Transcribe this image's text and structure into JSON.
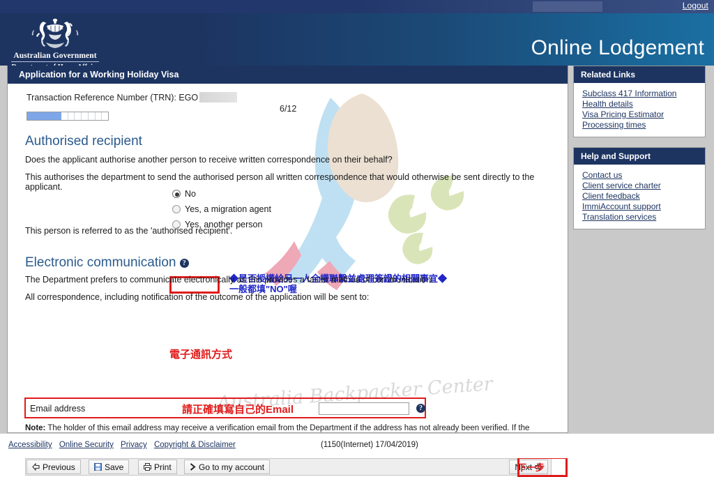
{
  "topbar": {
    "logout_label": "Logout"
  },
  "banner": {
    "title": "Online Lodgement",
    "crest_gov": "Australian Government",
    "crest_dept": "Department of Home Affairs"
  },
  "form": {
    "header": "Application for a Working Holiday Visa",
    "trn_label": "Transaction Reference Number (TRN): EGO",
    "page_count": "6/12",
    "progress": {
      "total": 12,
      "filled": 5
    }
  },
  "authorised_recipient": {
    "heading": "Authorised recipient",
    "q1": "Does the applicant authorise another person to receive written correspondence on their behalf?",
    "q2": "This authorises the department to send the authorised person all written correspondence that would otherwise be sent directly to the applicant.",
    "options": [
      {
        "label": "No",
        "selected": true
      },
      {
        "label": "Yes, a migration agent",
        "selected": false
      },
      {
        "label": "Yes, another person",
        "selected": false
      }
    ],
    "footnote": "This person is referred to as the 'authorised recipient'.",
    "annotation_line1": "◆是否授權給另一人全權聯繫並處理簽證的相關事宜◆",
    "annotation_line2": "一般都填\"NO\"喔"
  },
  "electronic_communication": {
    "heading": "Electronic communication",
    "heading_annotation": "電子通訊方式",
    "p1": "The Department prefers to communicate electronically as this provides a faster method of communication.",
    "p2": "All correspondence, including notification of the outcome of the application will be sent to:",
    "email_label": "Email address",
    "email_value": "",
    "email_placeholder": "",
    "email_annotation": "請正確填寫自己的Email",
    "note_bold": "Note:",
    "note_text": " The holder of this email address may receive a verification email from the Department if the address has not already been verified. If the address holder receives a verification email, they should click on the link to verify their address before this application is submitted."
  },
  "buttons": {
    "previous": "Previous",
    "save": "Save",
    "print": "Print",
    "go_to_account": "Go to my account",
    "next": "Next",
    "next_annotation": "下一步"
  },
  "related_links": {
    "title": "Related Links",
    "items": [
      "Subclass 417 Information",
      "Health details",
      "Visa Pricing Estimator",
      "Processing times"
    ]
  },
  "help_and_support": {
    "title": "Help and Support",
    "items": [
      "Contact us",
      "Client service charter",
      "Client feedback",
      "ImmiAccount support",
      "Translation services"
    ]
  },
  "footer": {
    "links": [
      "Accessibility",
      "Online Security",
      "Privacy",
      "Copyright & Disclaimer"
    ],
    "build": "(1150(Internet) 17/04/2019)"
  },
  "watermark": {
    "text": "Australia Backpacker Center"
  },
  "colors": {
    "navy": "#1d3461",
    "banner_blue": "#1b6fa2",
    "heading_blue": "#2a5a8c",
    "progress_fill": "#7da7e8",
    "annotation_red": "#e01b1b",
    "annotation_blue": "#1f26c9"
  }
}
